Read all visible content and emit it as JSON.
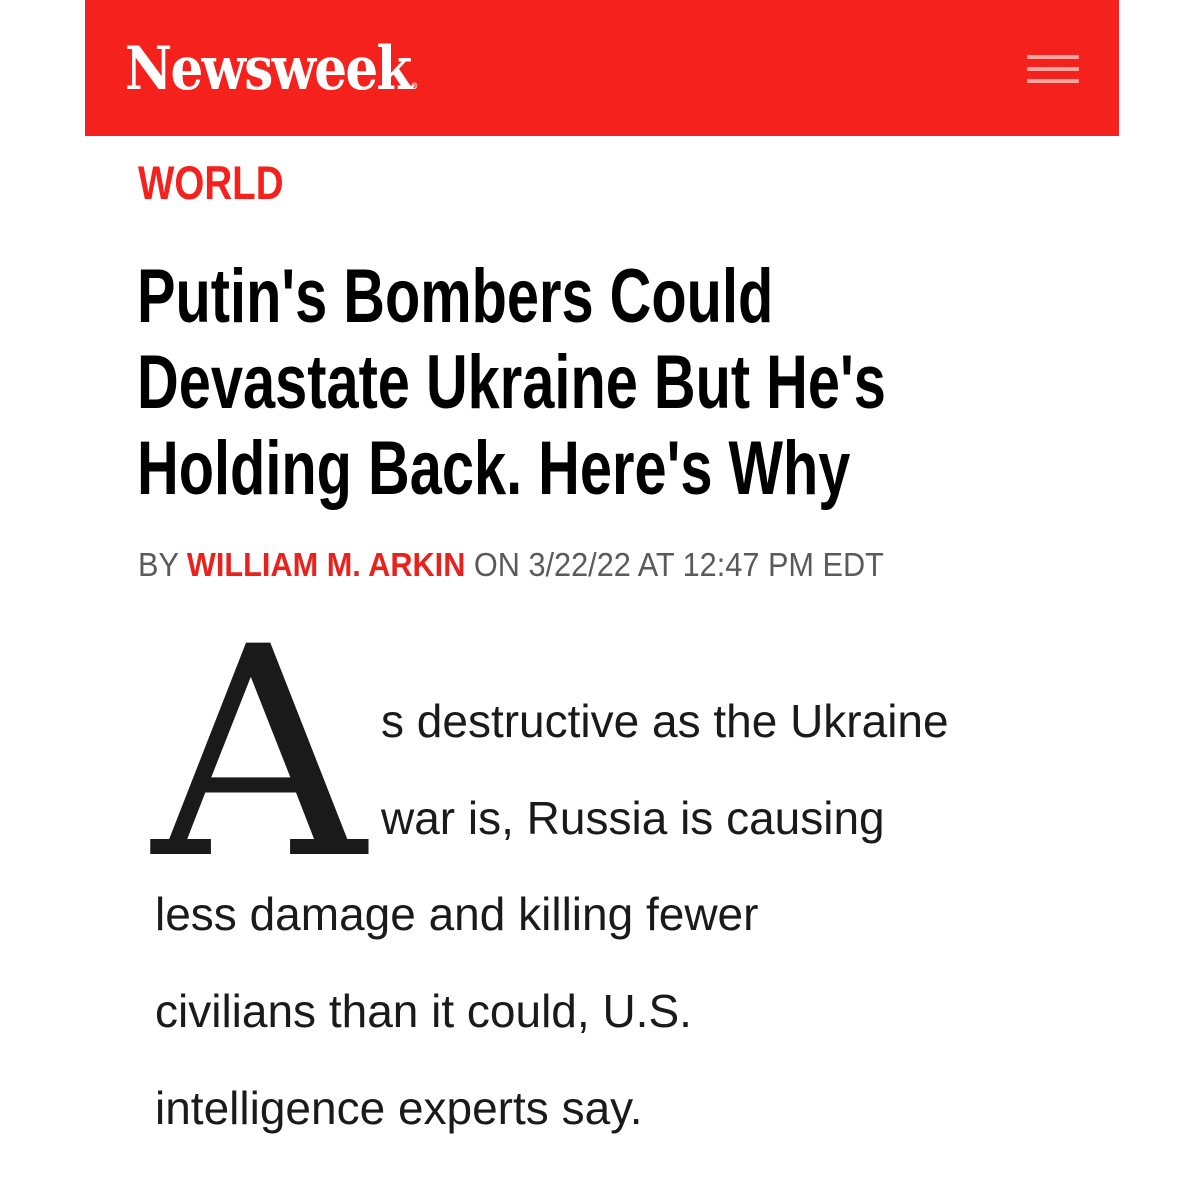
{
  "header": {
    "logo_text": "Newsweek",
    "logo_mark": "®",
    "menu_icon": "hamburger-menu-icon",
    "brand_color": "#f4211d"
  },
  "article": {
    "section": "WORLD",
    "headline_lines": [
      "Putin's Bombers Could",
      "Devastate Ukraine But He's",
      "Holding Back. Here's Why"
    ],
    "byline": {
      "prefix": "BY",
      "author": "WILLIAM M. ARKIN",
      "date_prefix": "ON",
      "date": "3/22/22",
      "time_prefix": "AT",
      "time": "12:47 PM EDT"
    },
    "drop_cap": "A",
    "body_lines": [
      "s destructive as the Ukraine",
      "war is, Russia is causing",
      "less damage and killing fewer",
      "civilians than it could, U.S.",
      "intelligence experts say."
    ]
  }
}
